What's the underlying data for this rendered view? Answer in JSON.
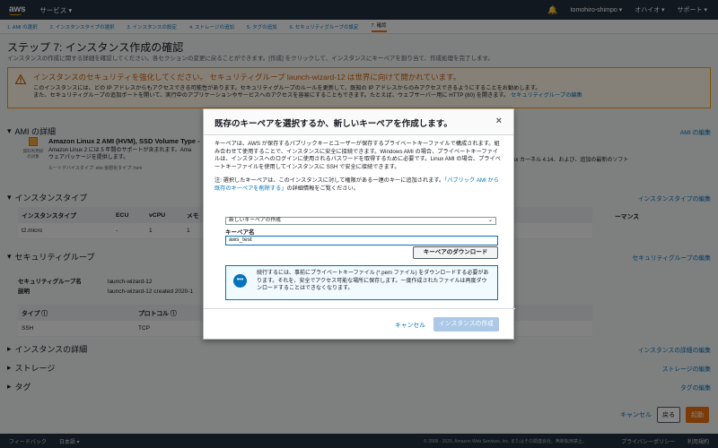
{
  "topbar": {
    "logo": "aws",
    "services": "サービス ▾",
    "user": "tomohiro-shimpo ▾",
    "region": "オハイオ ▾",
    "support": "サポート ▾"
  },
  "steps": [
    "1. AMI の選択",
    "2. インスタンスタイプの選択",
    "3. インスタンスの設定",
    "4. ストレージの追加",
    "5. タグの追加",
    "6. セキュリティグループの設定",
    "7. 確認"
  ],
  "page": {
    "title": "ステップ 7: インスタンス作成の確認",
    "desc": "インスタンスの作成に関する詳細を確認してください。各セクションの変更に戻ることができます。[作成] をクリックして、インスタンスにキーペアを割り当て、作成処理を完了します。"
  },
  "warning": {
    "title": "インスタンスのセキュリティを強化してください。 セキュリティグループ launch-wizard-12 は世界に向けて開かれています。",
    "line1": "このインスタンスには、どの IP アドレスからもアクセスできる可能性があります。セキュリティグループのルールを更新して、既知の IP アドレスからのみアクセスできるようにすることをお勧めします。",
    "line2": "また、セキュリティグループの追加ポートを開いて、実行中のアプリケーションやサービスへのアクセスを容易にすることもできます。たとえば、ウェブサーバー用に HTTP (80) を開きます。",
    "link": "セキュリティグループの編集"
  },
  "ami": {
    "head": "AMI の詳細",
    "edit": "AMI の編集",
    "icon_label1": "無料利用枠",
    "icon_label2": "の対象",
    "name": "Amazon Linux 2 AMI (HVM), SSD Volume Type - ",
    "desc1": "Amazon Linux 2 には 5 年間のサポートが含まれます。Ama",
    "desc2": "ウェアパッケージを提供します。",
    "root": "ルートデバイスタイプ: ebs   仮想化タイプ: hvm",
    "right": "Linux カーネル 4.14、および、追加の最新のソフト"
  },
  "itype": {
    "head": "インスタンスタイプ",
    "edit": "インスタンスタイプの編集",
    "cols": [
      "インスタンスタイプ",
      "ECU",
      "vCPU",
      "メモ"
    ],
    "last_col": "ーマンス",
    "row": [
      "t2.micro",
      "-",
      "1",
      "1"
    ]
  },
  "sg": {
    "head": "セキュリティグループ",
    "edit": "セキュリティグループの編集",
    "name_key": "セキュリティグループ名",
    "name_val": "launch-wizard-12",
    "desc_key": "説明",
    "desc_val": "launch-wizard-12 created 2020-1",
    "cols": [
      "タイプ ⓘ",
      "プロトコル ⓘ"
    ],
    "row": [
      "SSH",
      "TCP"
    ]
  },
  "details": {
    "head": "インスタンスの詳細",
    "edit": "インスタンスの詳細の編集"
  },
  "storage": {
    "head": "ストレージ",
    "edit": "ストレージの編集"
  },
  "tags": {
    "head": "タグ",
    "edit": "タグの編集"
  },
  "actions": {
    "cancel": "キャンセル",
    "back": "戻る",
    "launch": "起動"
  },
  "footer": {
    "feedback": "フィードバック",
    "lang": "日本語 ▾",
    "copyright": "© 2008 - 2020, Amazon Web Services, Inc. またはその関連会社。無断転用禁止。",
    "privacy": "プライバシーポリシー",
    "terms": "利用規約"
  },
  "modal": {
    "title": "既存のキーペアを選択するか、新しいキーペアを作成します。",
    "close": "×",
    "p1": "キーペアは、AWS が保存するパブリックキーとユーザーが保存するプライベートキーファイルで構成されます。組み合わせて使用することで、インスタンスに安全に接続できます。Windows AMI の場合、プライベートキーファイルは、インスタンスへのログインに使用されるパスワードを取得するために必要です。Linux AMI の場合、プライベートキーファイルを使用してインスタンスに SSH で安全に接続できます。",
    "p2a": "注: 選択したキーペアは、このインスタンスに対して権限がある一連のキーに追加されます。",
    "p2link": "「パブリック AMI から既存のキーペアを削除する」",
    "p2b": "の詳細情報をご覧ください。",
    "select": "新しいキーペアの作成",
    "keyname_label": "キーペア名",
    "keyname_value": "aws_test",
    "download": "キーペアのダウンロード",
    "info": "続行するには、事前にプライベートキーファイル (*.pem ファイル) をダウンロードする必要があります。それを、安全でアクセス可能な場所に保存します。一度作成されたファイルは再度ダウンロードすることはできなくなります。",
    "cancel": "キャンセル",
    "launch": "インスタンスの作成"
  }
}
